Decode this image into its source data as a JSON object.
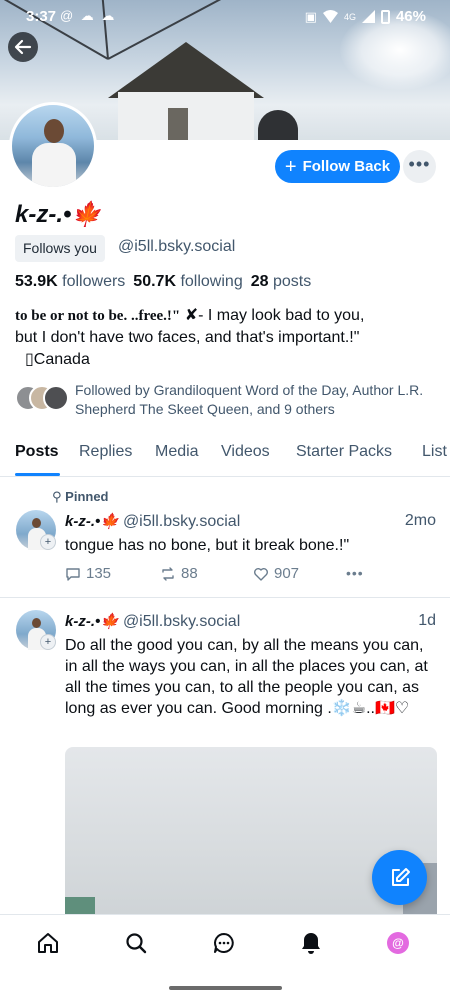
{
  "status_bar": {
    "time": "3:37",
    "left_icons": "@ ☁ ☁",
    "network": "4G",
    "battery": "46%"
  },
  "profile": {
    "display_name": "k-z-.•🍁",
    "follows_you_label": "Follows you",
    "handle": "@i5ll.bsky.social",
    "followers_count": "53.9K",
    "followers_label": "followers",
    "following_count": "50.7K",
    "following_label": "following",
    "posts_count": "28",
    "posts_label": "posts",
    "bio_serif": "to be or not to be. ..free.!\"",
    "bio_line1_rest": "✘- I may look bad to you,",
    "bio_line2": "but I don't have two faces, and that's important.!\"",
    "bio_line3": "▯Canada",
    "known_followers": "Followed by Grandiloquent Word of the Day, Author L.R. Shepherd The Skeet Queen, and 9 others"
  },
  "actions": {
    "follow_back_label": "Follow Back",
    "more_label": "•••"
  },
  "tabs": [
    {
      "label": "Posts"
    },
    {
      "label": "Replies"
    },
    {
      "label": "Media"
    },
    {
      "label": "Videos"
    },
    {
      "label": "Starter Packs"
    },
    {
      "label": "List"
    }
  ],
  "posts": [
    {
      "pinned_label": "Pinned",
      "author": "k-z-.•🍁",
      "handle": "@i5ll.bsky.social",
      "time": "2mo",
      "text": "tongue has no bone, but it break bone.!\"",
      "replies": "135",
      "reposts": "88",
      "likes": "907"
    },
    {
      "author": "k-z-.•🍁",
      "handle": "@i5ll.bsky.social",
      "time": "1d",
      "text": "Do all the good you can, by all the means you can, in all the ways you can, in all the places you can, at all the times you can, to all the people you can, as long as ever you can. Good morning .❄️☕..🇨🇦♡"
    }
  ],
  "nav": {
    "items": [
      "home-icon",
      "search-icon",
      "chat-icon",
      "notifications-icon",
      "profile-avatar"
    ],
    "avatar_glyph": "@"
  },
  "colors": {
    "accent": "#1083fe",
    "muted": "#42576c",
    "text": "#0b0f14"
  }
}
